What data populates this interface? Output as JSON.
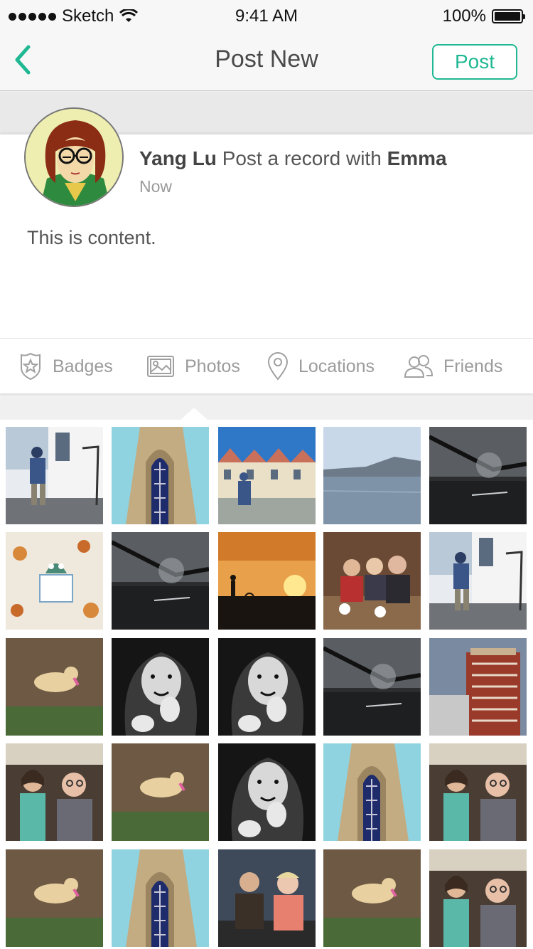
{
  "status_bar": {
    "carrier": "Sketch",
    "time": "9:41 AM",
    "battery": "100%"
  },
  "nav": {
    "title": "Post New",
    "post_label": "Post"
  },
  "post": {
    "author": "Yang Lu",
    "action": "Post a record with",
    "with_user": "Emma",
    "time": "Now",
    "content": "This is content."
  },
  "tabs": [
    {
      "label": "Badges",
      "icon": "badge-icon"
    },
    {
      "label": "Photos",
      "icon": "photo-icon"
    },
    {
      "label": "Locations",
      "icon": "location-pin-icon"
    },
    {
      "label": "Friends",
      "icon": "friends-icon"
    }
  ],
  "colors": {
    "accent": "#1fb893"
  },
  "photos": [
    "boy-at-window",
    "church-window",
    "painted-ladies",
    "bay-view",
    "bridge-fog",
    "owl-craft",
    "bridge-fog",
    "sunset-silhouette",
    "dinner-group",
    "boy-at-window",
    "dog-on-grass",
    "girl-bw",
    "girl-bw",
    "bridge-fog",
    "hotel-building",
    "couple-selfie",
    "dog-on-grass",
    "girl-bw",
    "church-window",
    "couple-selfie",
    "dog-on-grass",
    "church-window",
    "couple-dinner",
    "dog-on-grass",
    "couple-selfie"
  ]
}
